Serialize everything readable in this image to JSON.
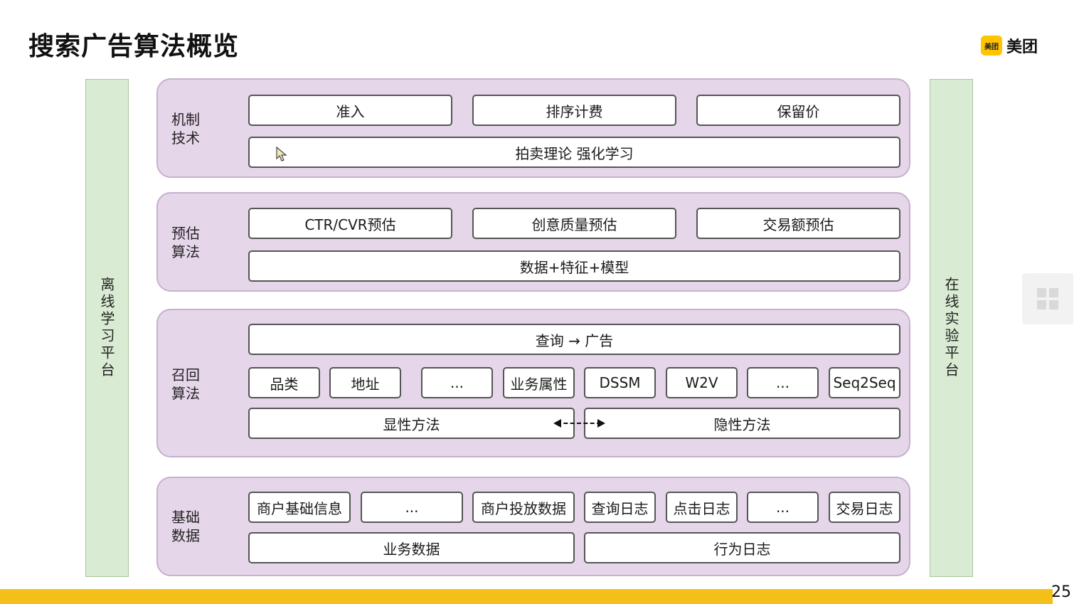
{
  "title": "搜索广告算法概览",
  "logo": {
    "mark_text": "美团",
    "text": "美团",
    "color": "#ffc300"
  },
  "side_left": "离线学习平台",
  "side_right": "在线实验平台",
  "mechanism": {
    "label": "机制技术",
    "items": [
      "准入",
      "排序计费",
      "保留价"
    ],
    "wide": "拍卖理论 强化学习"
  },
  "prediction": {
    "label": "预估算法",
    "items": [
      "CTR/CVR预估",
      "创意质量预估",
      "交易额预估"
    ],
    "wide": "数据+特征+模型"
  },
  "recall": {
    "label": "召回算法",
    "top": "查询 → 广告",
    "items": [
      "品类",
      "地址",
      "...",
      "业务属性",
      "DSSM",
      "W2V",
      "...",
      "Seq2Seq"
    ],
    "explicit": "显性方法",
    "implicit": "隐性方法"
  },
  "base_data": {
    "label": "基础数据",
    "items": [
      "商户基础信息",
      "...",
      "商户投放数据",
      "查询日志",
      "点击日志",
      "...",
      "交易日志"
    ],
    "business": "业务数据",
    "behavior": "行为日志"
  },
  "page_number": "25",
  "icons": [
    "cursor-icon",
    "grid-icon",
    "dashed-double-arrow-icon"
  ],
  "colors": {
    "panel": "#e6d6ea",
    "side": "#d9ebd3",
    "footer": "#f5bf1a"
  }
}
